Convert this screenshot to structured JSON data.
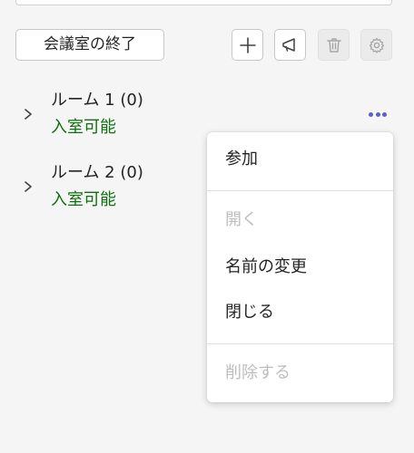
{
  "toolbar": {
    "end_meeting_label": "会議室の終了",
    "icons": [
      "plus-icon",
      "megaphone-icon",
      "trash-icon",
      "gear-icon"
    ]
  },
  "rooms": [
    {
      "name": "ルーム 1 (0)",
      "status": "入室可能"
    },
    {
      "name": "ルーム 2 (0)",
      "status": "入室可能"
    }
  ],
  "menu": {
    "items": [
      {
        "label": "参加",
        "enabled": true
      },
      {
        "label": "開く",
        "enabled": false
      },
      {
        "label": "名前の変更",
        "enabled": true
      },
      {
        "label": "閉じる",
        "enabled": true
      },
      {
        "label": "削除する",
        "enabled": false
      }
    ]
  },
  "colors": {
    "accent": "#5b5fc7",
    "status_green": "#0e700e",
    "disabled_text": "#bdbdbd",
    "background": "#f5f5f5"
  }
}
